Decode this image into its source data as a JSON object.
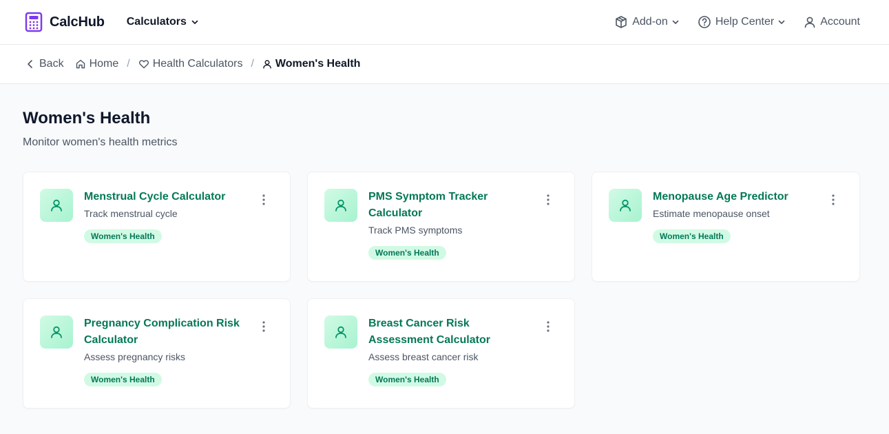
{
  "header": {
    "brand": "CalcHub",
    "calculators_label": "Calculators",
    "addon_label": "Add-on",
    "help_label": "Help Center",
    "account_label": "Account"
  },
  "breadcrumb": {
    "back": "Back",
    "home": "Home",
    "health": "Health Calculators",
    "current": "Women's Health",
    "separator": "/"
  },
  "page": {
    "title": "Women's Health",
    "subtitle": "Monitor women's health metrics"
  },
  "cards": [
    {
      "title": "Menstrual Cycle Calculator",
      "desc": "Track menstrual cycle",
      "badge": "Women's Health"
    },
    {
      "title": "PMS Symptom Tracker Calculator",
      "desc": "Track PMS symptoms",
      "badge": "Women's Health"
    },
    {
      "title": "Menopause Age Predictor",
      "desc": "Estimate menopause onset",
      "badge": "Women's Health"
    },
    {
      "title": "Pregnancy Complication Risk Calculator",
      "desc": "Assess pregnancy risks",
      "badge": "Women's Health"
    },
    {
      "title": "Breast Cancer Risk Assessment Calculator",
      "desc": "Assess breast cancer risk",
      "badge": "Women's Health"
    }
  ],
  "icons": {
    "logo": "calculator-icon",
    "card": "user-icon",
    "addon": "package-icon",
    "help": "help-circle-icon",
    "account": "user-icon"
  },
  "colors": {
    "brand": "#7c3aed",
    "accent": "#047857",
    "badge_bg": "#d1fae5"
  }
}
